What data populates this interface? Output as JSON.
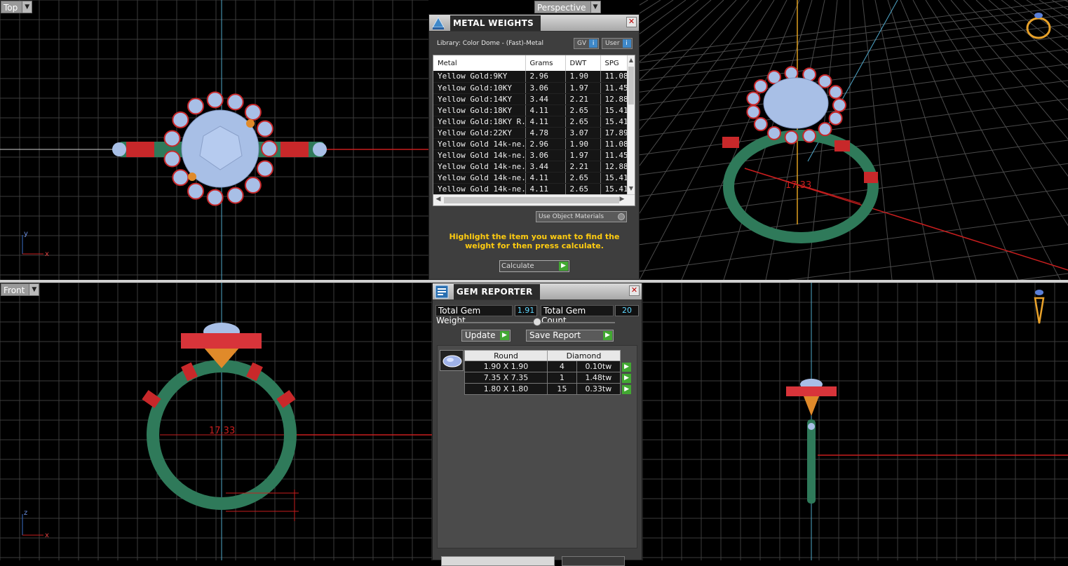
{
  "viewports": {
    "top": {
      "label": "Top"
    },
    "perspective": {
      "label": "Perspective"
    },
    "front": {
      "label": "Front"
    },
    "right": {
      "label": ""
    }
  },
  "dimensions": {
    "front_width": "17.33",
    "persp_width": "17.33"
  },
  "metal_weights": {
    "title": "METAL WEIGHTS",
    "library": "Library: Color Dome - (Fast)-Metal",
    "toggle_gv": "GV",
    "toggle_user": "User",
    "columns": [
      "Metal",
      "Grams",
      "DWT",
      "SPG"
    ],
    "rows": [
      [
        "Yellow Gold:9KY",
        "2.96",
        "1.90",
        "11.08"
      ],
      [
        "Yellow Gold:10KY",
        "3.06",
        "1.97",
        "11.45"
      ],
      [
        "Yellow Gold:14KY",
        "3.44",
        "2.21",
        "12.88"
      ],
      [
        "Yellow Gold:18KY",
        "4.11",
        "2.65",
        "15.41"
      ],
      [
        "Yellow Gold:18KY R...",
        "4.11",
        "2.65",
        "15.41"
      ],
      [
        "Yellow Gold:22KY",
        "4.78",
        "3.07",
        "17.89"
      ],
      [
        "Yellow Gold 14k-ne...",
        "2.96",
        "1.90",
        "11.08"
      ],
      [
        "Yellow Gold 14k-ne...",
        "3.06",
        "1.97",
        "11.45"
      ],
      [
        "Yellow Gold 14k-ne...",
        "3.44",
        "2.21",
        "12.88"
      ],
      [
        "Yellow Gold 14k-ne...",
        "4.11",
        "2.65",
        "15.41"
      ],
      [
        "Yellow Gold 14k-ne...",
        "4.11",
        "2.65",
        "15.41"
      ]
    ],
    "use_object_materials": "Use Object Materials",
    "hint": "Highlight the item you want to find the weight for then press calculate.",
    "calculate": "Calculate"
  },
  "gem_reporter": {
    "title": "GEM REPORTER",
    "total_weight_label": "Total Gem Weight",
    "total_weight": "1.91",
    "total_count_label": "Total Gem Count",
    "total_count": "20",
    "update": "Update",
    "save_report": "Save Report",
    "shape": "Round",
    "stone": "Diamond",
    "rows": [
      {
        "size": "1.90 X 1.90",
        "qty": "4",
        "tw": "0.10tw"
      },
      {
        "size": "7.35 X 7.35",
        "qty": "1",
        "tw": "1.48tw"
      },
      {
        "size": "1.80 X 1.80",
        "qty": "15",
        "tw": "0.33tw"
      }
    ]
  },
  "colors": {
    "band": "#2f7a5a",
    "gem": "#a8bfe6",
    "prong": "#c8282a",
    "accent": "#ffcc10",
    "grid": "#3a3a3a"
  }
}
